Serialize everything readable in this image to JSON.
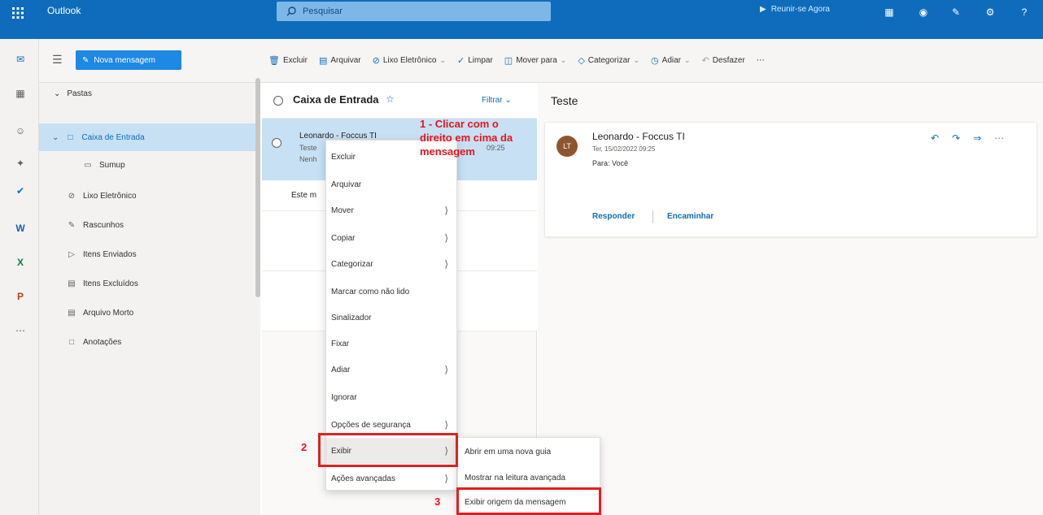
{
  "app": {
    "title": "Outlook"
  },
  "search": {
    "placeholder": "Pesquisar"
  },
  "topbar": {
    "meet_now": "Reunir-se Agora"
  },
  "commandbar": {
    "new_message": "Nova mensagem",
    "actions": [
      {
        "label": "Excluir",
        "icon": "trash-icon",
        "chevron": false
      },
      {
        "label": "Arquivar",
        "icon": "archive-icon",
        "chevron": false
      },
      {
        "label": "Lixo Eletrônico",
        "icon": "block-icon",
        "chevron": true
      },
      {
        "label": "Limpar",
        "icon": "broom-icon",
        "chevron": false
      },
      {
        "label": "Mover para",
        "icon": "folder-move-icon",
        "chevron": true
      },
      {
        "label": "Categorizar",
        "icon": "tag-icon",
        "chevron": true
      },
      {
        "label": "Adiar",
        "icon": "clock-icon",
        "chevron": true
      },
      {
        "label": "Desfazer",
        "icon": "undo-icon",
        "chevron": false
      }
    ]
  },
  "folders": {
    "header": "Pastas",
    "items": [
      {
        "label": "Caixa de Entrada",
        "icon": "inbox-icon",
        "selected": true
      },
      {
        "label": "Sumup",
        "icon": "folder-icon",
        "selected": false
      },
      {
        "label": "Lixo Eletrônico",
        "icon": "block-icon",
        "selected": false
      },
      {
        "label": "Rascunhos",
        "icon": "pencil-icon",
        "selected": false
      },
      {
        "label": "Itens Enviados",
        "icon": "send-icon",
        "selected": false
      },
      {
        "label": "Itens Excluídos",
        "icon": "trash-icon",
        "selected": false
      },
      {
        "label": "Arquivo Morto",
        "icon": "archive-icon",
        "selected": false
      },
      {
        "label": "Anotações",
        "icon": "note-icon",
        "selected": false
      }
    ]
  },
  "message_list": {
    "title": "Caixa de Entrada",
    "filter": "Filtrar",
    "selected_message": {
      "from": "Leonardo - Foccus TI",
      "subject": "Teste",
      "preview": "Nenh",
      "time": "09:25"
    },
    "group_label": "Este m"
  },
  "reading_pane": {
    "subject": "Teste",
    "avatar_initials": "LT",
    "from": "Leonardo - Foccus TI",
    "date": "Ter, 15/02/2022 09:25",
    "to": "Para: Você",
    "reply": "Responder",
    "forward": "Encaminhar"
  },
  "context_menu": {
    "items": [
      {
        "label": "Excluir",
        "submenu": false
      },
      {
        "label": "Arquivar",
        "submenu": false
      },
      {
        "label": "Mover",
        "submenu": true
      },
      {
        "label": "Copiar",
        "submenu": true
      },
      {
        "label": "Categorizar",
        "submenu": true
      },
      {
        "label": "Marcar como não lido",
        "submenu": false
      },
      {
        "label": "Sinalizador",
        "submenu": false
      },
      {
        "label": "Fixar",
        "submenu": false
      },
      {
        "label": "Adiar",
        "submenu": true
      },
      {
        "label": "Ignorar",
        "submenu": false
      },
      {
        "label": "Opções de segurança",
        "submenu": true
      },
      {
        "label": "Exibir",
        "submenu": true
      },
      {
        "label": "Ações avançadas",
        "submenu": true
      }
    ],
    "submenu_items": [
      {
        "label": "Abrir em uma nova guia"
      },
      {
        "label": "Mostrar na leitura avançada"
      },
      {
        "label": "Exibir origem da mensagem"
      }
    ]
  },
  "annotations": {
    "step1": "1 - Clicar com o direito em cima da mensagem",
    "step2": "2",
    "step3": "3"
  },
  "colors": {
    "brand": "#0f6cbd",
    "selected_bg": "#c7e0f4",
    "annotation": "#e8141b"
  }
}
